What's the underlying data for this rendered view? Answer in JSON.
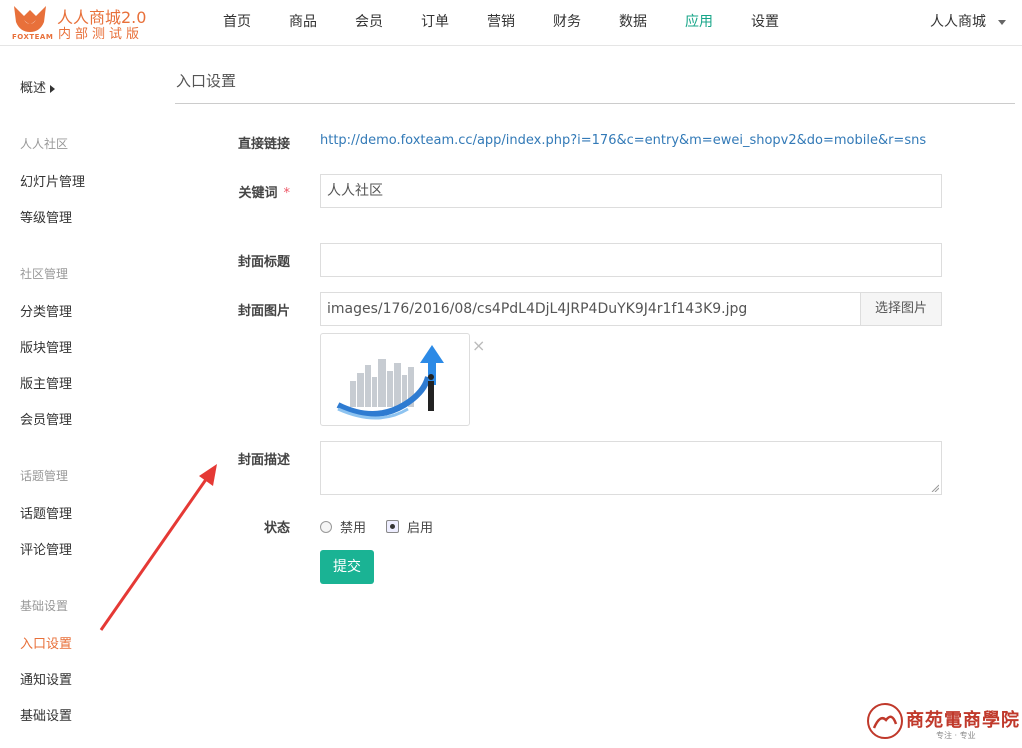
{
  "brand": {
    "title": "人人商城2.0",
    "tagline": "内部测试版",
    "sub": "FOXTEAM",
    "color": "#e8703a"
  },
  "nav": {
    "items": [
      "首页",
      "商品",
      "会员",
      "订单",
      "营销",
      "财务",
      "数据",
      "应用",
      "设置"
    ],
    "active": "应用",
    "active_color": "#18a689",
    "user": "人人商城"
  },
  "sidebar": {
    "overview": "概述",
    "group1": "人人社区",
    "slides": "幻灯片管理",
    "levels": "等级管理",
    "group2": "社区管理",
    "category": "分类管理",
    "board": "版块管理",
    "moderator": "版主管理",
    "members": "会员管理",
    "group3": "话题管理",
    "topics": "话题管理",
    "comments": "评论管理",
    "group4": "基础设置",
    "entry": "入口设置",
    "notify": "通知设置",
    "basic": "基础设置",
    "active": "入口设置"
  },
  "page": {
    "title": "入口设置"
  },
  "form": {
    "link_label": "直接链接",
    "link_value": "http://demo.foxteam.cc/app/index.php?i=176&c=entry&m=ewei_shopv2&do=mobile&r=sns",
    "keyword_label": "关键词",
    "required_mark": "*",
    "keyword_value": "人人社区",
    "cover_title_label": "封面标题",
    "cover_title_value": "",
    "cover_image_label": "封面图片",
    "cover_image_value": "images/176/2016/08/cs4PdL4DjL4JRP4DuYK9J4r1f143K9.jpg",
    "pick_image": "选择图片",
    "remove_icon": "×",
    "cover_desc_label": "封面描述",
    "cover_desc_value": "",
    "status_label": "状态",
    "status_options": [
      "禁用",
      "启用"
    ],
    "status_selected": "启用",
    "submit": "提交"
  },
  "watermark": {
    "text": "商苑電商學院",
    "sub": "专注 · 专业"
  }
}
